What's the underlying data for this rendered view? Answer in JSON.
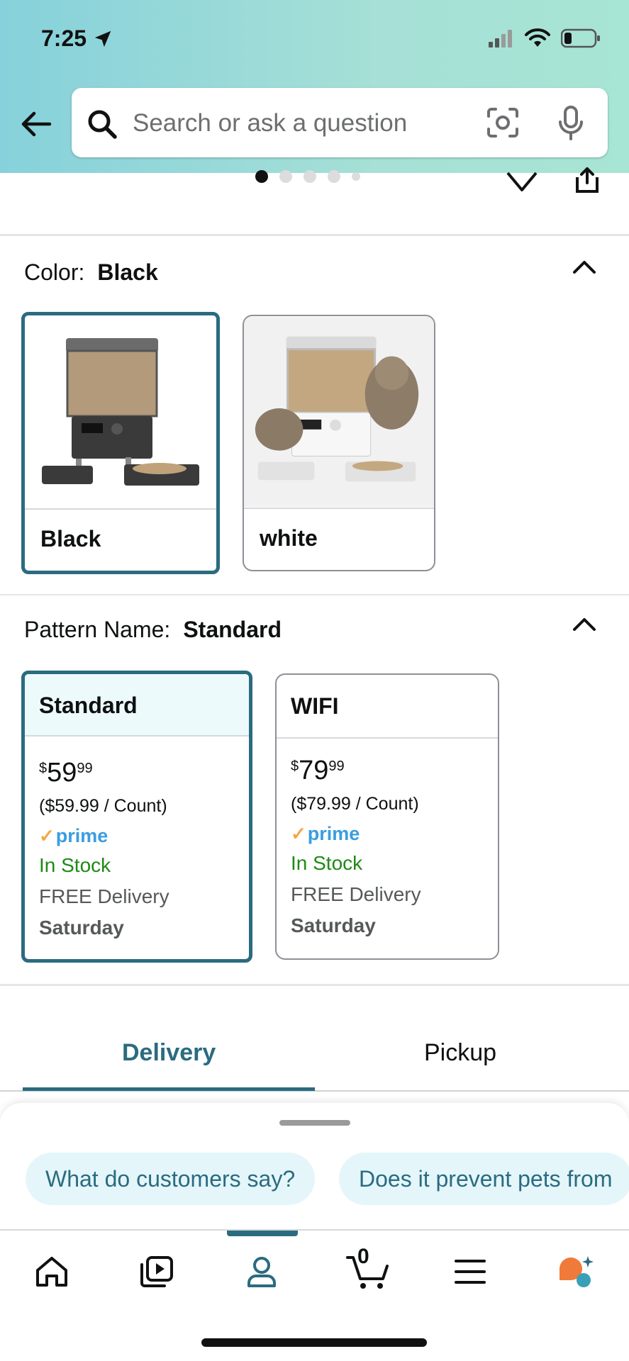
{
  "status_bar": {
    "time": "7:25"
  },
  "search": {
    "placeholder": "Search or ask a question"
  },
  "color_section": {
    "label": "Color:",
    "value": "Black",
    "options": [
      {
        "label": "Black"
      },
      {
        "label": "white"
      }
    ]
  },
  "pattern_section": {
    "label": "Pattern Name:",
    "value": "Standard",
    "options": [
      {
        "title": "Standard",
        "currency": "$",
        "price_whole": "59",
        "price_fraction": "99",
        "per_count": "($59.99 / Count)",
        "prime": "prime",
        "stock": "In Stock",
        "delivery": "FREE Delivery",
        "delivery_day": "Saturday"
      },
      {
        "title": "WIFI",
        "currency": "$",
        "price_whole": "79",
        "price_fraction": "99",
        "per_count": "($79.99 / Count)",
        "prime": "prime",
        "stock": "In Stock",
        "delivery": "FREE Delivery",
        "delivery_day": "Saturday"
      }
    ]
  },
  "tabs": [
    {
      "label": "Delivery",
      "active": true
    },
    {
      "label": "Pickup",
      "active": false
    }
  ],
  "chips": [
    {
      "label": "What do customers say?"
    },
    {
      "label": "Does it prevent pets from"
    }
  ],
  "bottom_nav": {
    "items": [
      {
        "icon": "home-icon"
      },
      {
        "icon": "video-icon"
      },
      {
        "icon": "account-icon",
        "active": true
      },
      {
        "icon": "cart-icon"
      },
      {
        "icon": "menu-icon"
      },
      {
        "icon": "rufus-assistant-icon"
      }
    ],
    "cart_count": "0"
  },
  "colors": {
    "accent": "#2b6b80",
    "stock_green": "#1f8a15",
    "prime_blue": "#3a9de0"
  }
}
